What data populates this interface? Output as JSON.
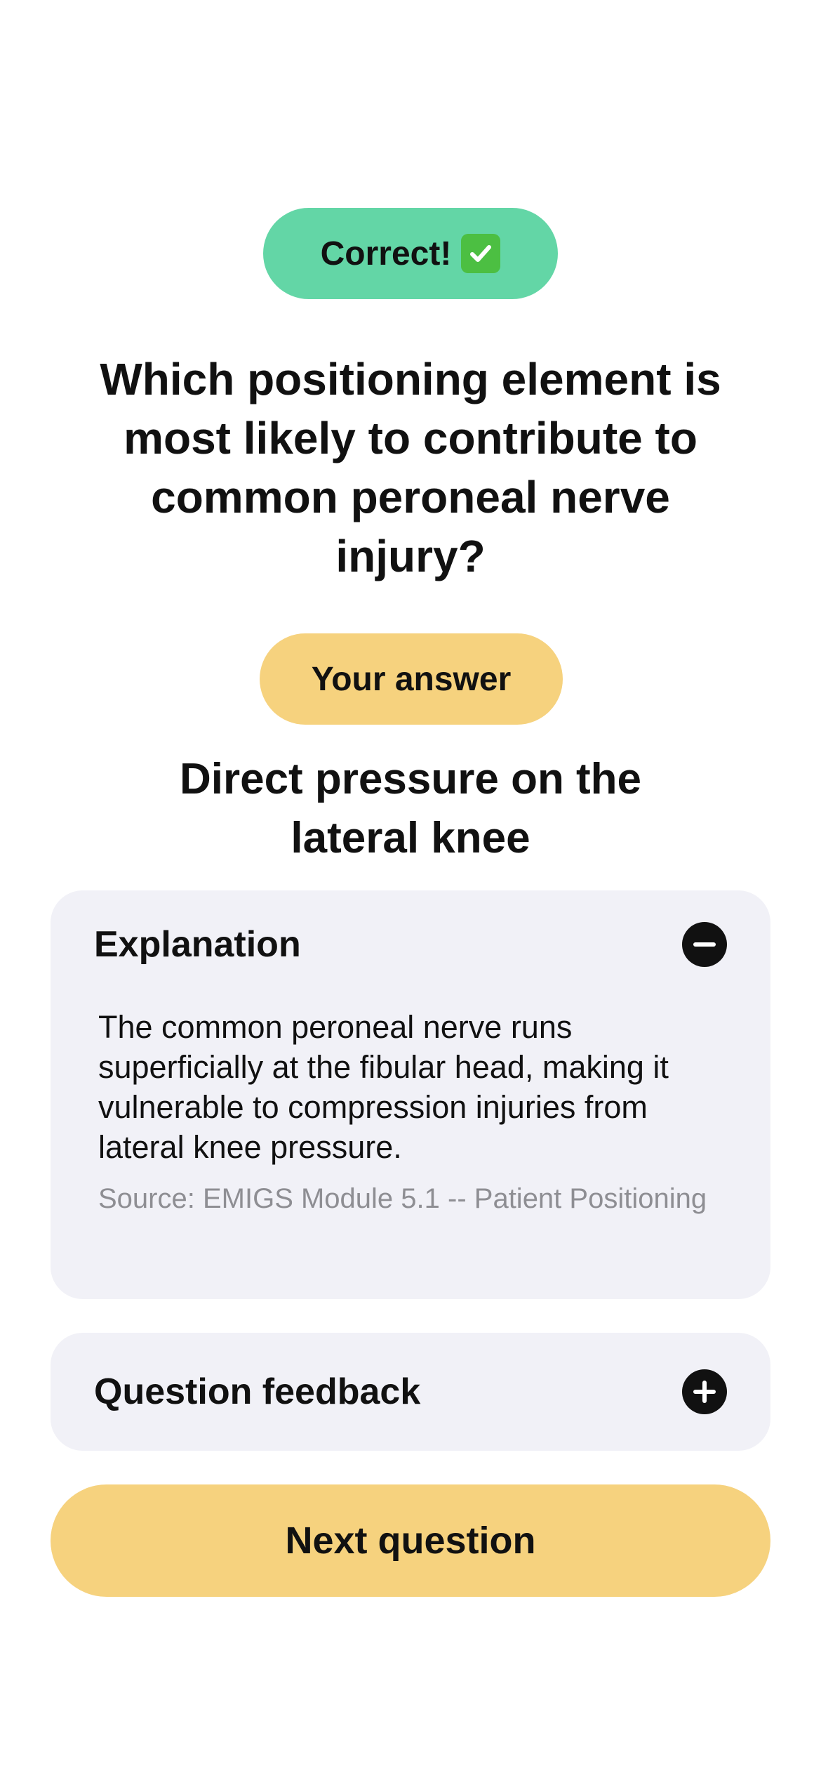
{
  "result": {
    "label": "Correct!",
    "icon": "check-mark-box-icon",
    "color": "#63d6a6"
  },
  "question": {
    "text": "Which positioning element is most likely to contribute to common peroneal nerve injury?"
  },
  "your_answer": {
    "badge_label": "Your answer",
    "text": "Direct pressure on the lateral knee"
  },
  "explanation": {
    "title": "Explanation",
    "expanded": true,
    "toggle_icon": "minus-circle-icon",
    "body": "The common peroneal nerve runs superficially at the fibular head, making it vulnerable to compression injuries from lateral knee pressure.",
    "source": "Source: EMIGS Module 5.1 -- Patient Positioning"
  },
  "feedback": {
    "title": "Question feedback",
    "expanded": false,
    "toggle_icon": "plus-circle-icon"
  },
  "next_button": {
    "label": "Next question",
    "color": "#f6d27e"
  }
}
